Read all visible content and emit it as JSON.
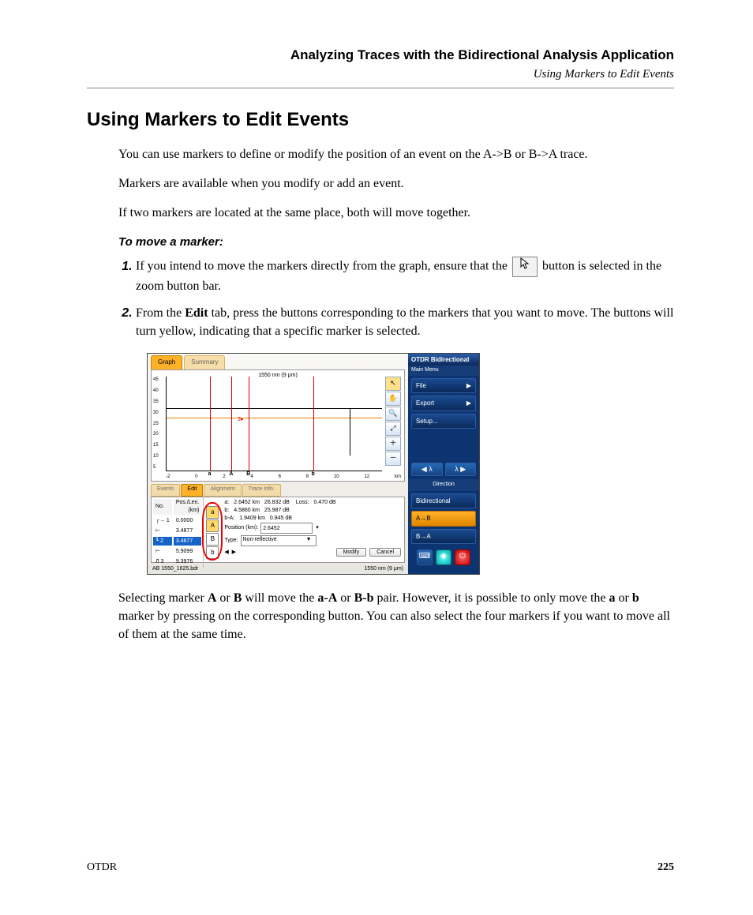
{
  "header": {
    "chapter": "Analyzing Traces with the Bidirectional Analysis Application",
    "section": "Using Markers to Edit Events"
  },
  "title": "Using Markers to Edit Events",
  "paras": {
    "p1": "You can use markers to define or modify the position of an event on the A->B or B->A trace.",
    "p2": "Markers are available when you modify or add an event.",
    "p3": "If two markers are located at the same place, both will move together."
  },
  "subhead": "To move a marker:",
  "steps": {
    "s1a": "If you intend to move the markers directly from the graph, ensure that the ",
    "s1b": " button is selected in the zoom button bar.",
    "s2a": "From the ",
    "s2b": "Edit",
    "s2c": " tab, press the buttons corresponding to the markers that you want to move. The buttons will turn yellow, indicating that a specific marker is selected."
  },
  "after": {
    "t1": "Selecting marker ",
    "A": "A",
    "or": " or ",
    "B": "B",
    "t2": " will move the ",
    "aA": "a-A",
    "BB": "B-b",
    "t3": " pair. However, it is possible to only move the ",
    "a": "a",
    "b": "b",
    "t4": " marker by pressing on the corresponding button. You can also select the four markers if you want to move all of them at the same time."
  },
  "footer": {
    "product": "OTDR",
    "page": "225"
  },
  "ss": {
    "tabs": {
      "graph": "Graph",
      "summary": "Summary"
    },
    "graphTitle": "1550 nm (9 µm)",
    "yTicks": [
      "45",
      "40",
      "35",
      "30",
      "25",
      "20",
      "15",
      "10",
      "5"
    ],
    "xTicks": [
      "-2",
      "0",
      "2",
      "4",
      "6",
      "8",
      "10",
      "12",
      "km"
    ],
    "markers": {
      "a": "a",
      "A": "A",
      "B": "B",
      "b": "b",
      "two": "2"
    },
    "lowerTabs": {
      "events": "Events",
      "edit": "Edit",
      "alignment": "Alignment",
      "traceinfo": "Trace Info."
    },
    "tableHead": {
      "no": "No.",
      "pos": "Pos./Len.",
      "unit": "(km)"
    },
    "rows": [
      {
        "n": "1",
        "pos": "0.0000"
      },
      {
        "n": "",
        "pos": "3.4877"
      },
      {
        "n": "2",
        "pos": "3.4877"
      },
      {
        "n": "",
        "pos": "5.9099"
      },
      {
        "n": "3",
        "pos": "9.3976"
      }
    ],
    "markerBtns": {
      "a": "a",
      "A": "A",
      "B": "B",
      "b": "b"
    },
    "info": {
      "ab_a": "a:",
      "ab_a_km": "2.6452 km",
      "ab_a_db": "26.832 dB",
      "loss_lbl": "Loss:",
      "loss": "0.470 dB",
      "ab_b": "b:",
      "ab_b_km": "4.5860 km",
      "ab_b_db": "25.987 dB",
      "ba": "b-A:",
      "ba_km": "1.9409 km",
      "ba_db": "0.845 dB",
      "pos_lbl": "Position (km):",
      "pos_val": "2.6452",
      "type_lbl": "Type:",
      "type_val": "Non-reflective",
      "modify": "Modify",
      "cancel": "Cancel"
    },
    "status": {
      "file": "AB 1550_1625.bdr",
      "wl": "1550 nm (9 µm)"
    },
    "side": {
      "title": "OTDR Bidirectional",
      "mainmenu": "Main Menu",
      "file": "File",
      "export": "Export",
      "setup": "Setup...",
      "lambdaL": "◀ λ",
      "lambdaR": "λ ▶",
      "direction": "Direction",
      "bidi": "Bidirectional",
      "ab": "A→B",
      "ba": "B→A"
    }
  }
}
